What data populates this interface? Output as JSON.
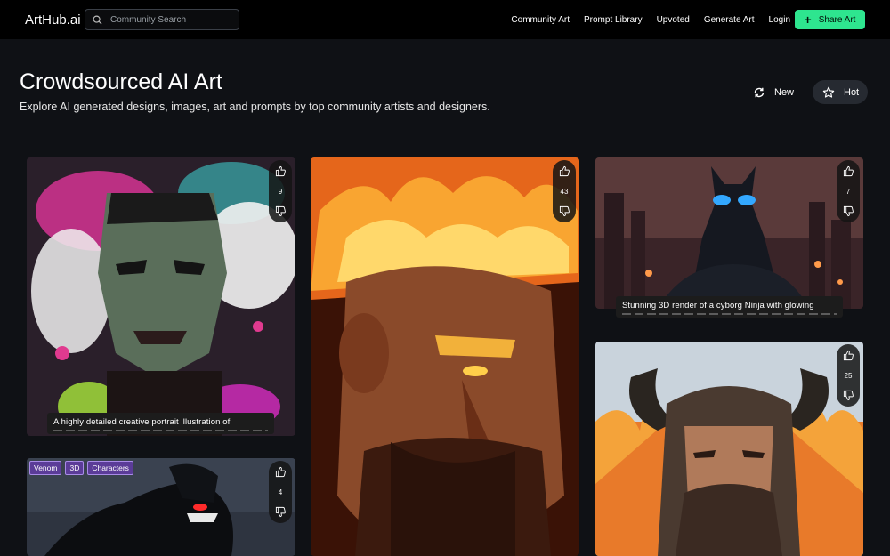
{
  "nav": {
    "logo": "ArtHub.ai",
    "search_placeholder": "Community Search",
    "links": [
      "Community Art",
      "Prompt Library",
      "Upvoted",
      "Generate Art",
      "Login"
    ],
    "share_label": "Share Art",
    "accent": "#2ee58f"
  },
  "hero": {
    "title": "Crowdsourced AI Art",
    "subtitle": "Explore AI generated designs, images, art and prompts by top community artists and designers.",
    "sort_new": "New",
    "sort_hot": "Hot"
  },
  "cards": [
    {
      "id": "frankenstein",
      "votes": "9",
      "caption": "A highly detailed creative portrait illustration of"
    },
    {
      "id": "fire-warrior",
      "votes": "43",
      "caption": ""
    },
    {
      "id": "cyborg-ninja",
      "votes": "7",
      "caption": "Stunning 3D render of a cyborg Ninja with glowing"
    },
    {
      "id": "viking",
      "votes": "25",
      "caption": ""
    },
    {
      "id": "venom",
      "votes": "4",
      "tags": [
        "Venom",
        "3D",
        "Characters"
      ]
    }
  ]
}
